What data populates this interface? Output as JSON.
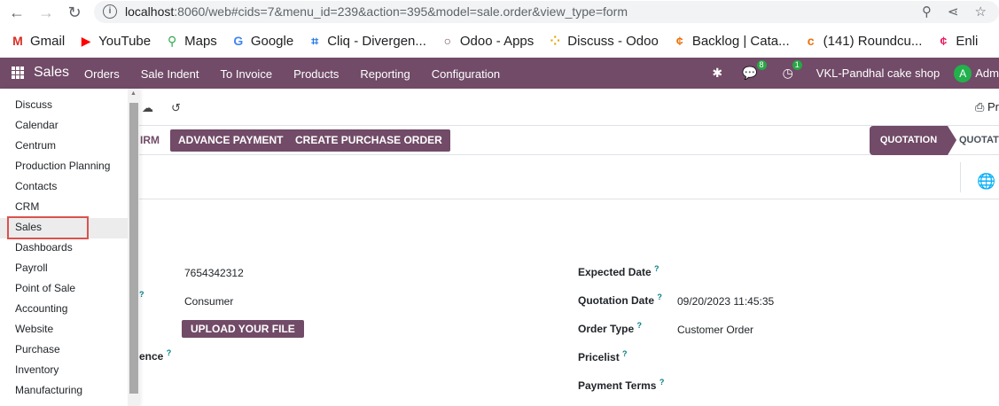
{
  "browser": {
    "url_host": "localhost",
    "url_rest": ":8060/web#cids=7&menu_id=239&action=395&model=sale.order&view_type=form",
    "bookmarks": [
      {
        "label": "Gmail",
        "icon": "gmail-icon",
        "glyph": "M",
        "color": "#d93025"
      },
      {
        "label": "YouTube",
        "icon": "youtube-icon",
        "glyph": "▶",
        "color": "#ff0000"
      },
      {
        "label": "Maps",
        "icon": "maps-icon",
        "glyph": "⚲",
        "color": "#34a853"
      },
      {
        "label": "Google",
        "icon": "google-icon",
        "glyph": "G",
        "color": "#4285f4"
      },
      {
        "label": "Cliq - Divergen...",
        "icon": "cliq-icon",
        "glyph": "⌗",
        "color": "#1a73e8"
      },
      {
        "label": "Odoo - Apps",
        "icon": "odoo-icon",
        "glyph": "○",
        "color": "#714b67"
      },
      {
        "label": "Discuss - Odoo",
        "icon": "discuss-icon",
        "glyph": "⁘",
        "color": "#e8a200"
      },
      {
        "label": "Backlog | Cata...",
        "icon": "backlog-icon",
        "glyph": "¢",
        "color": "#e8710a"
      },
      {
        "label": "(141) Roundcu...",
        "icon": "roundcube-icon",
        "glyph": "c",
        "color": "#e8710a"
      },
      {
        "label": "Enli",
        "icon": "enlite-icon",
        "glyph": "¢",
        "color": "#e91e63"
      }
    ]
  },
  "navbar": {
    "app_name": "Sales",
    "menu": [
      "Orders",
      "Sale Indent",
      "To Invoice",
      "Products",
      "Reporting",
      "Configuration"
    ],
    "messages_count": "8",
    "activities_count": "1",
    "company": "VKL-Pandhal cake shop",
    "user_initial": "A",
    "user_name_partial": "Adm"
  },
  "control": {
    "print_partial": "Pr"
  },
  "status_bar": {
    "confirm_partial": "IRM",
    "advance_payment": "ADVANCE PAYMENT",
    "create_po": "CREATE PURCHASE ORDER",
    "stage_active": "QUOTATION",
    "stage_next": "QUOTATIO"
  },
  "form": {
    "left": {
      "phone": "7654342312",
      "customer_type": "Consumer",
      "upload": "UPLOAD YOUR FILE",
      "reference_partial": "ence"
    },
    "right": {
      "expected_date_label": "Expected Date",
      "quotation_date_label": "Quotation Date",
      "quotation_date_value": "09/20/2023 11:45:35",
      "order_type_label": "Order Type",
      "order_type_value": "Customer Order",
      "pricelist_label": "Pricelist",
      "payment_terms_label": "Payment Terms"
    },
    "help_mark": "?"
  },
  "apps_menu": {
    "items": [
      "Discuss",
      "Calendar",
      "Centrum",
      "Production Planning",
      "Contacts",
      "CRM",
      "Sales",
      "Dashboards",
      "Payroll",
      "Point of Sale",
      "Accounting",
      "Website",
      "Purchase",
      "Inventory",
      "Manufacturing"
    ],
    "active": "Sales"
  },
  "colors": {
    "brand": "#714b67",
    "badge": "#28a745",
    "highlight_outline": "#d9534f"
  }
}
